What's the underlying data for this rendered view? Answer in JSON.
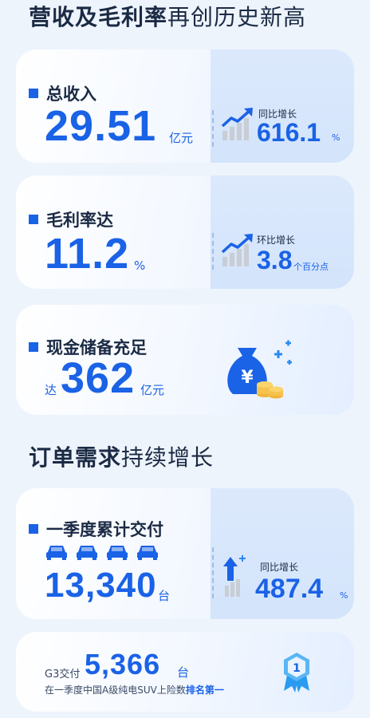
{
  "section1": {
    "title_bold": "营收及毛利率",
    "title_light": "再创历史新高"
  },
  "revenue": {
    "label": "总收入",
    "value": "29.51",
    "unit": "亿元",
    "stat_label": "同比增长",
    "stat_value": "616.1",
    "stat_unit": "%"
  },
  "margin": {
    "label": "毛利率达",
    "value": "11.2",
    "unit": "%",
    "stat_label": "环比增长",
    "stat_value": "3.8",
    "stat_unit": "个百分点"
  },
  "cash": {
    "label": "现金储备充足",
    "prefix": "达",
    "value": "362",
    "unit": "亿元"
  },
  "section2": {
    "title_bold": "订单需求",
    "title_light": "持续增长"
  },
  "deliveries": {
    "label": "一季度累计交付",
    "value": "13,340",
    "unit": "台",
    "stat_label": "同比增长",
    "stat_value": "487.4",
    "stat_unit": "%"
  },
  "g3": {
    "prefix": "G3交付",
    "value": "5,366",
    "unit": "台",
    "note_plain": "在一季度中国A级纯电SUV上险数",
    "note_bold": "排名第一",
    "badge": "1"
  },
  "colors": {
    "accent": "#1a62e6",
    "background": "#eef4fc"
  }
}
